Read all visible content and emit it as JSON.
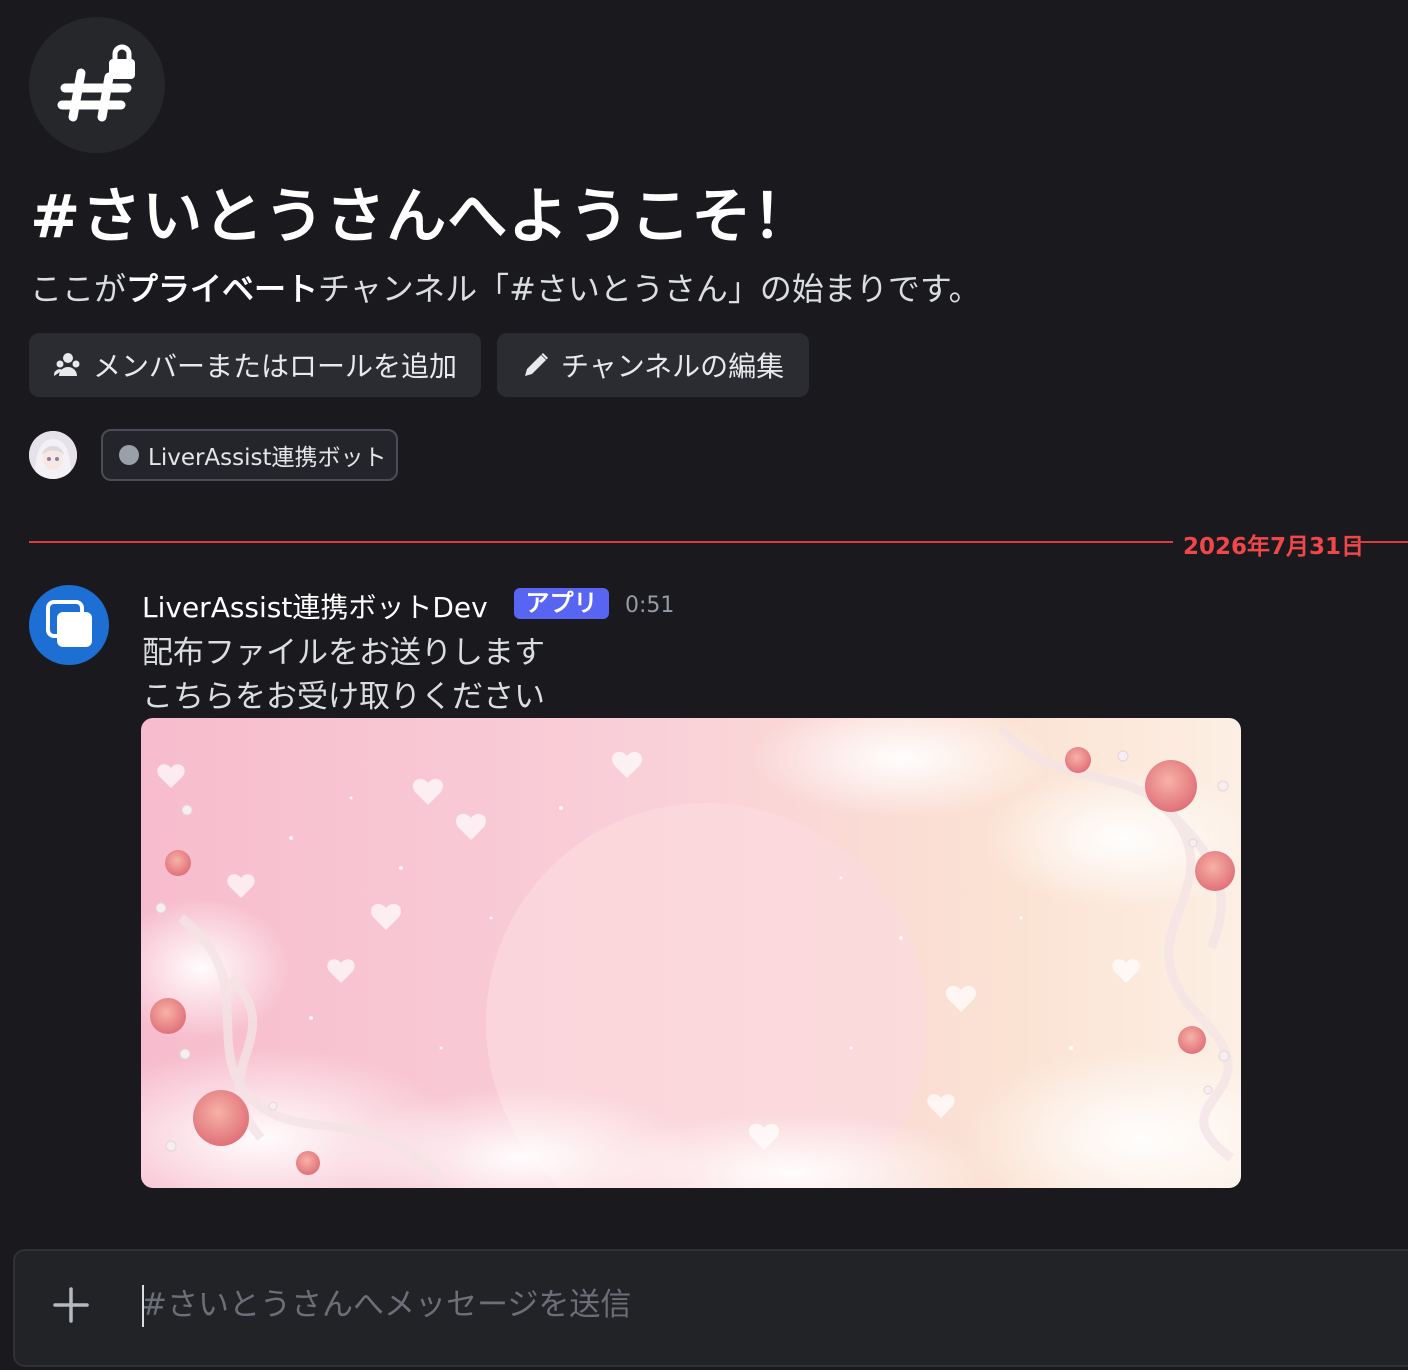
{
  "channel": {
    "icon": "hash-lock-icon",
    "welcome_title": "#さいとうさんへようこそ！",
    "desc_prefix": "ここが",
    "desc_bold": "プライベート",
    "desc_suffix": "チャンネル「#さいとうさん」の始まりです。"
  },
  "actions": {
    "add_member_label": "メンバーまたはロールを追加",
    "add_member_icon": "add-member-icon",
    "edit_channel_label": "チャンネルの編集",
    "edit_channel_icon": "pencil-icon"
  },
  "members": {
    "chip_label": "LiverAssist連携ボット"
  },
  "divider": {
    "date": "2026年7月31日"
  },
  "message": {
    "author": "LiverAssist連携ボットDev",
    "badge": "アプリ",
    "time": "0:51",
    "line1": "配布ファイルをお送りします",
    "line2": "こちらをお受け取りください"
  },
  "composer": {
    "placeholder": "#さいとうさんへメッセージを送信",
    "plus_icon": "plus-icon"
  },
  "colors": {
    "background": "#1a1a1e",
    "accent": "#5865f2",
    "divider": "#d83c3e",
    "avatar_blue": "#1d6fd3"
  }
}
